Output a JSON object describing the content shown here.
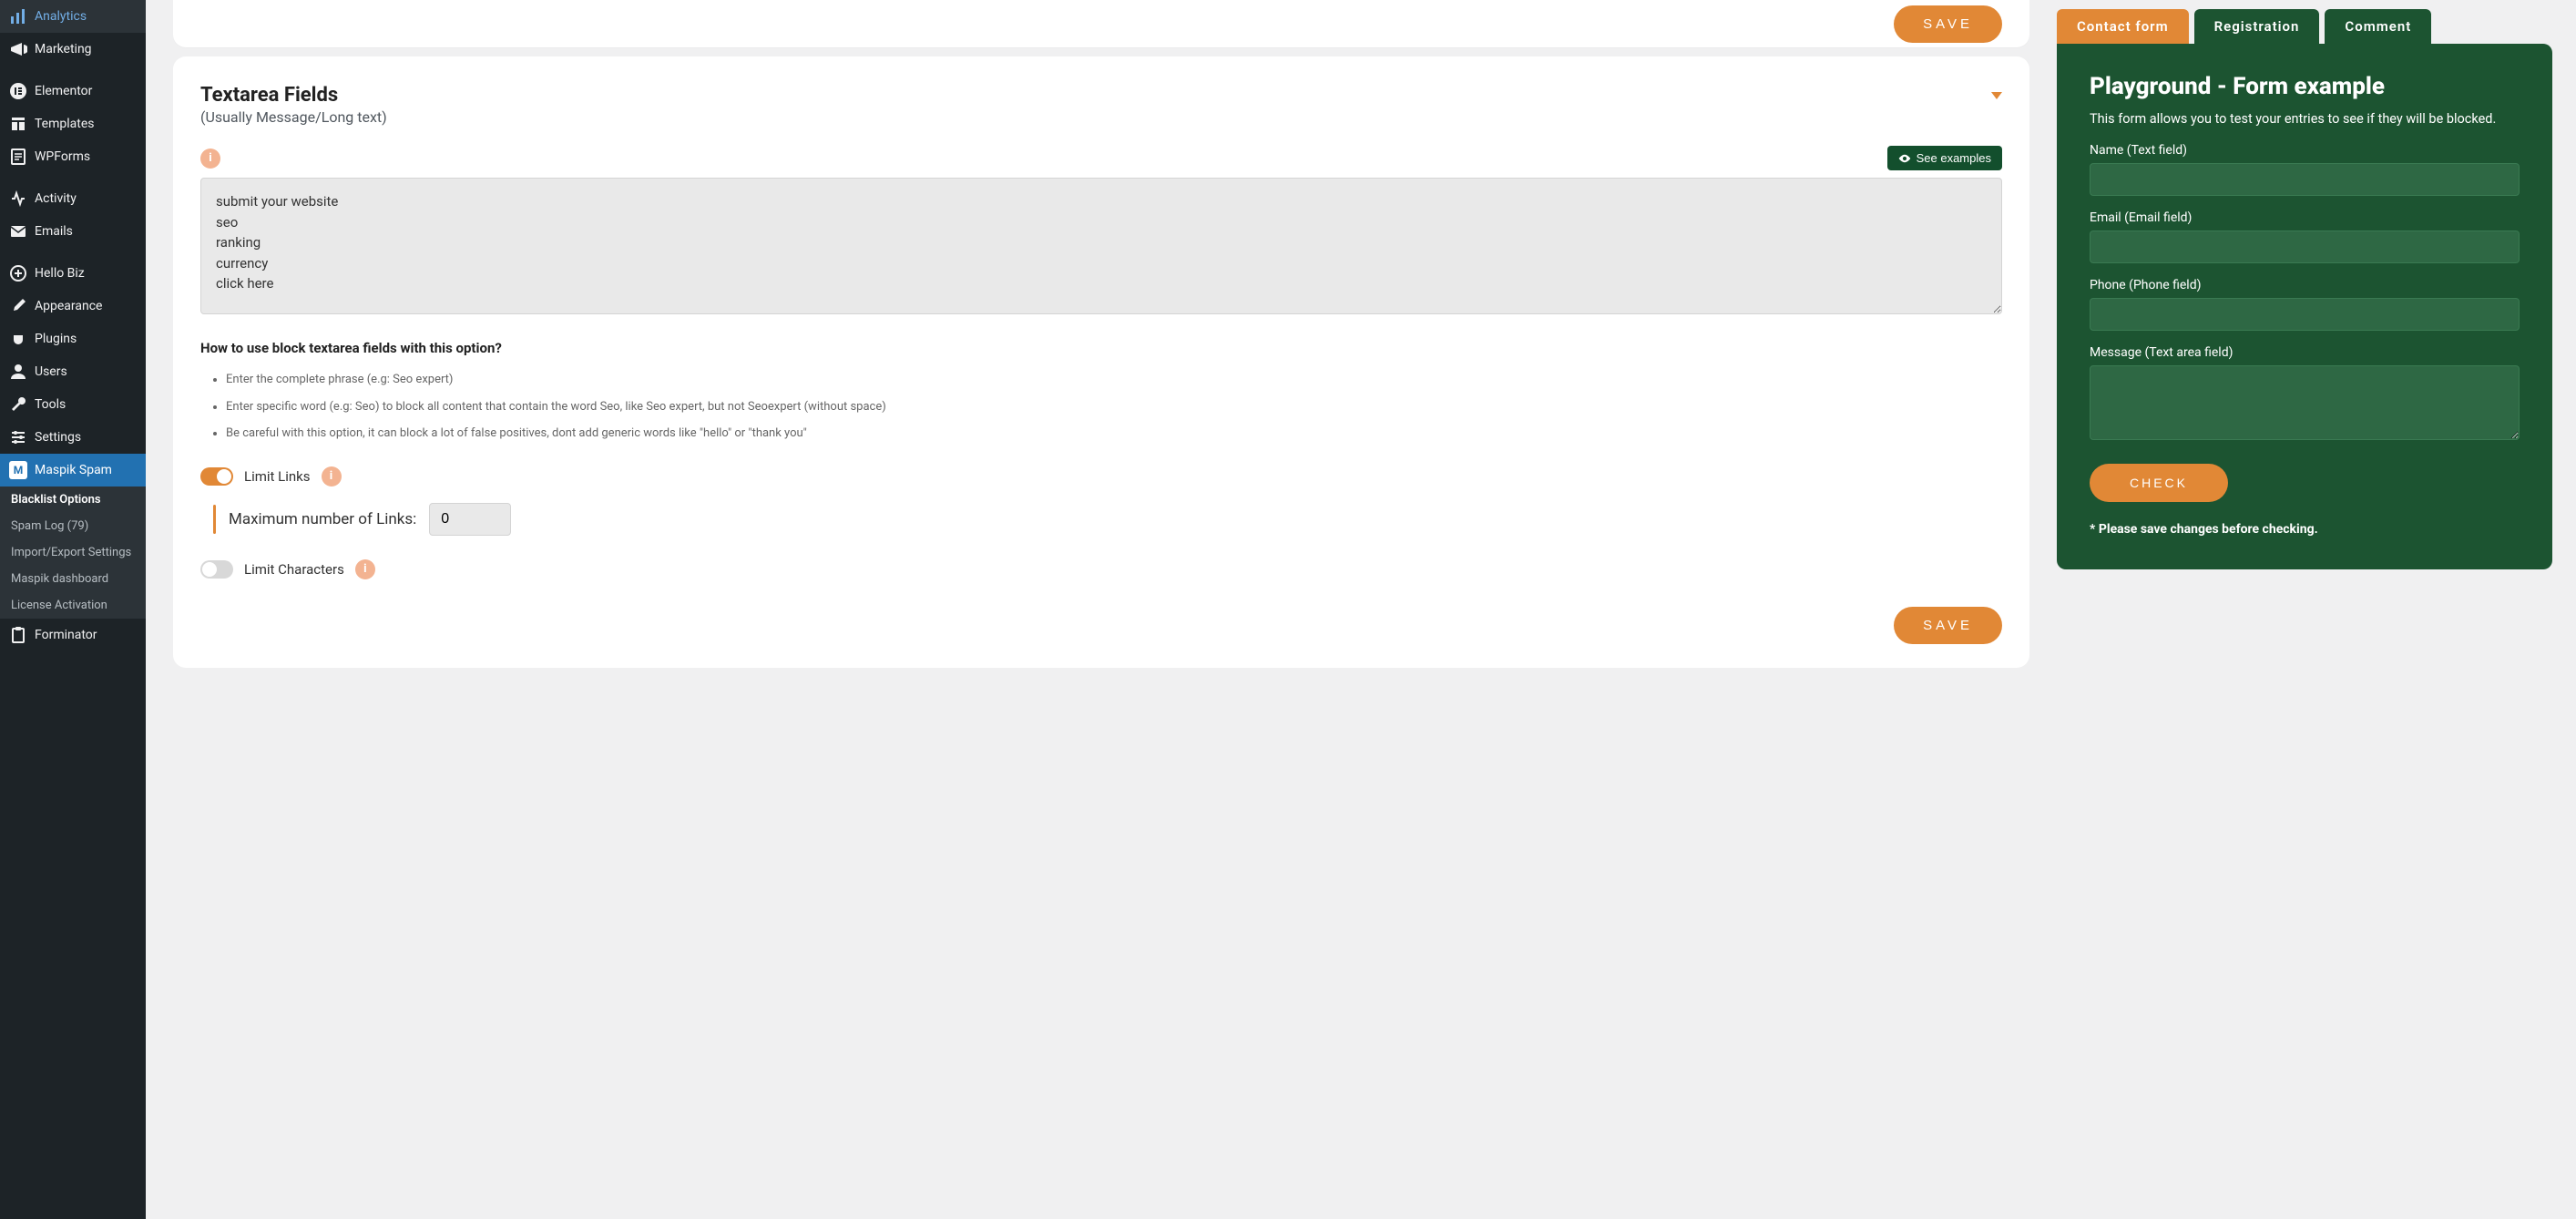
{
  "sidebar": {
    "items": [
      {
        "label": "Analytics",
        "icon": "bars"
      },
      {
        "label": "Marketing",
        "icon": "megaphone"
      },
      {
        "label": "Elementor",
        "icon": "elementor"
      },
      {
        "label": "Templates",
        "icon": "templates"
      },
      {
        "label": "WPForms",
        "icon": "form"
      },
      {
        "label": "Activity",
        "icon": "activity"
      },
      {
        "label": "Emails",
        "icon": "mail"
      },
      {
        "label": "Hello Biz",
        "icon": "plus"
      },
      {
        "label": "Appearance",
        "icon": "brush"
      },
      {
        "label": "Plugins",
        "icon": "plug"
      },
      {
        "label": "Users",
        "icon": "user"
      },
      {
        "label": "Tools",
        "icon": "wrench"
      },
      {
        "label": "Settings",
        "icon": "sliders"
      },
      {
        "label": "Maspik Spam",
        "icon": "m",
        "active": true
      },
      {
        "label": "Forminator",
        "icon": "clipboard"
      }
    ],
    "submenu": [
      {
        "label": "Blacklist Options",
        "active": true
      },
      {
        "label": "Spam Log (79)"
      },
      {
        "label": "Import/Export Settings"
      },
      {
        "label": "Maspik dashboard"
      },
      {
        "label": "License Activation"
      }
    ]
  },
  "top_save_label": "SAVE",
  "card": {
    "title": "Textarea Fields",
    "subtitle": "(Usually Message/Long text)",
    "see_examples": "See examples",
    "textarea_value": "submit your website\nseo\nranking\ncurrency\nclick here",
    "howto_title": "How to use block textarea fields with this option?",
    "howto_items": [
      "Enter the complete phrase (e.g: Seo expert)",
      "Enter specific word (e.g: Seo) to block all content that contain the word Seo, like Seo expert, but not Seoexpert (without space)",
      "Be careful with this option, it can block a lot of false positives, dont add generic words like \"hello\" or \"thank you\""
    ],
    "limit_links_label": "Limit Links",
    "max_links_label": "Maximum number of Links:",
    "max_links_value": "0",
    "limit_chars_label": "Limit Characters",
    "save_label": "SAVE"
  },
  "playground": {
    "tabs": [
      {
        "label": "Contact form",
        "active": true
      },
      {
        "label": "Registration"
      },
      {
        "label": "Comment"
      }
    ],
    "title": "Playground - Form example",
    "desc": "This form allows you to test your entries to see if they will be blocked.",
    "fields": {
      "name_label": "Name (Text field)",
      "email_label": "Email (Email field)",
      "phone_label": "Phone (Phone field)",
      "message_label": "Message (Text area field)"
    },
    "check_label": "CHECK",
    "note": "* Please save changes before checking."
  }
}
